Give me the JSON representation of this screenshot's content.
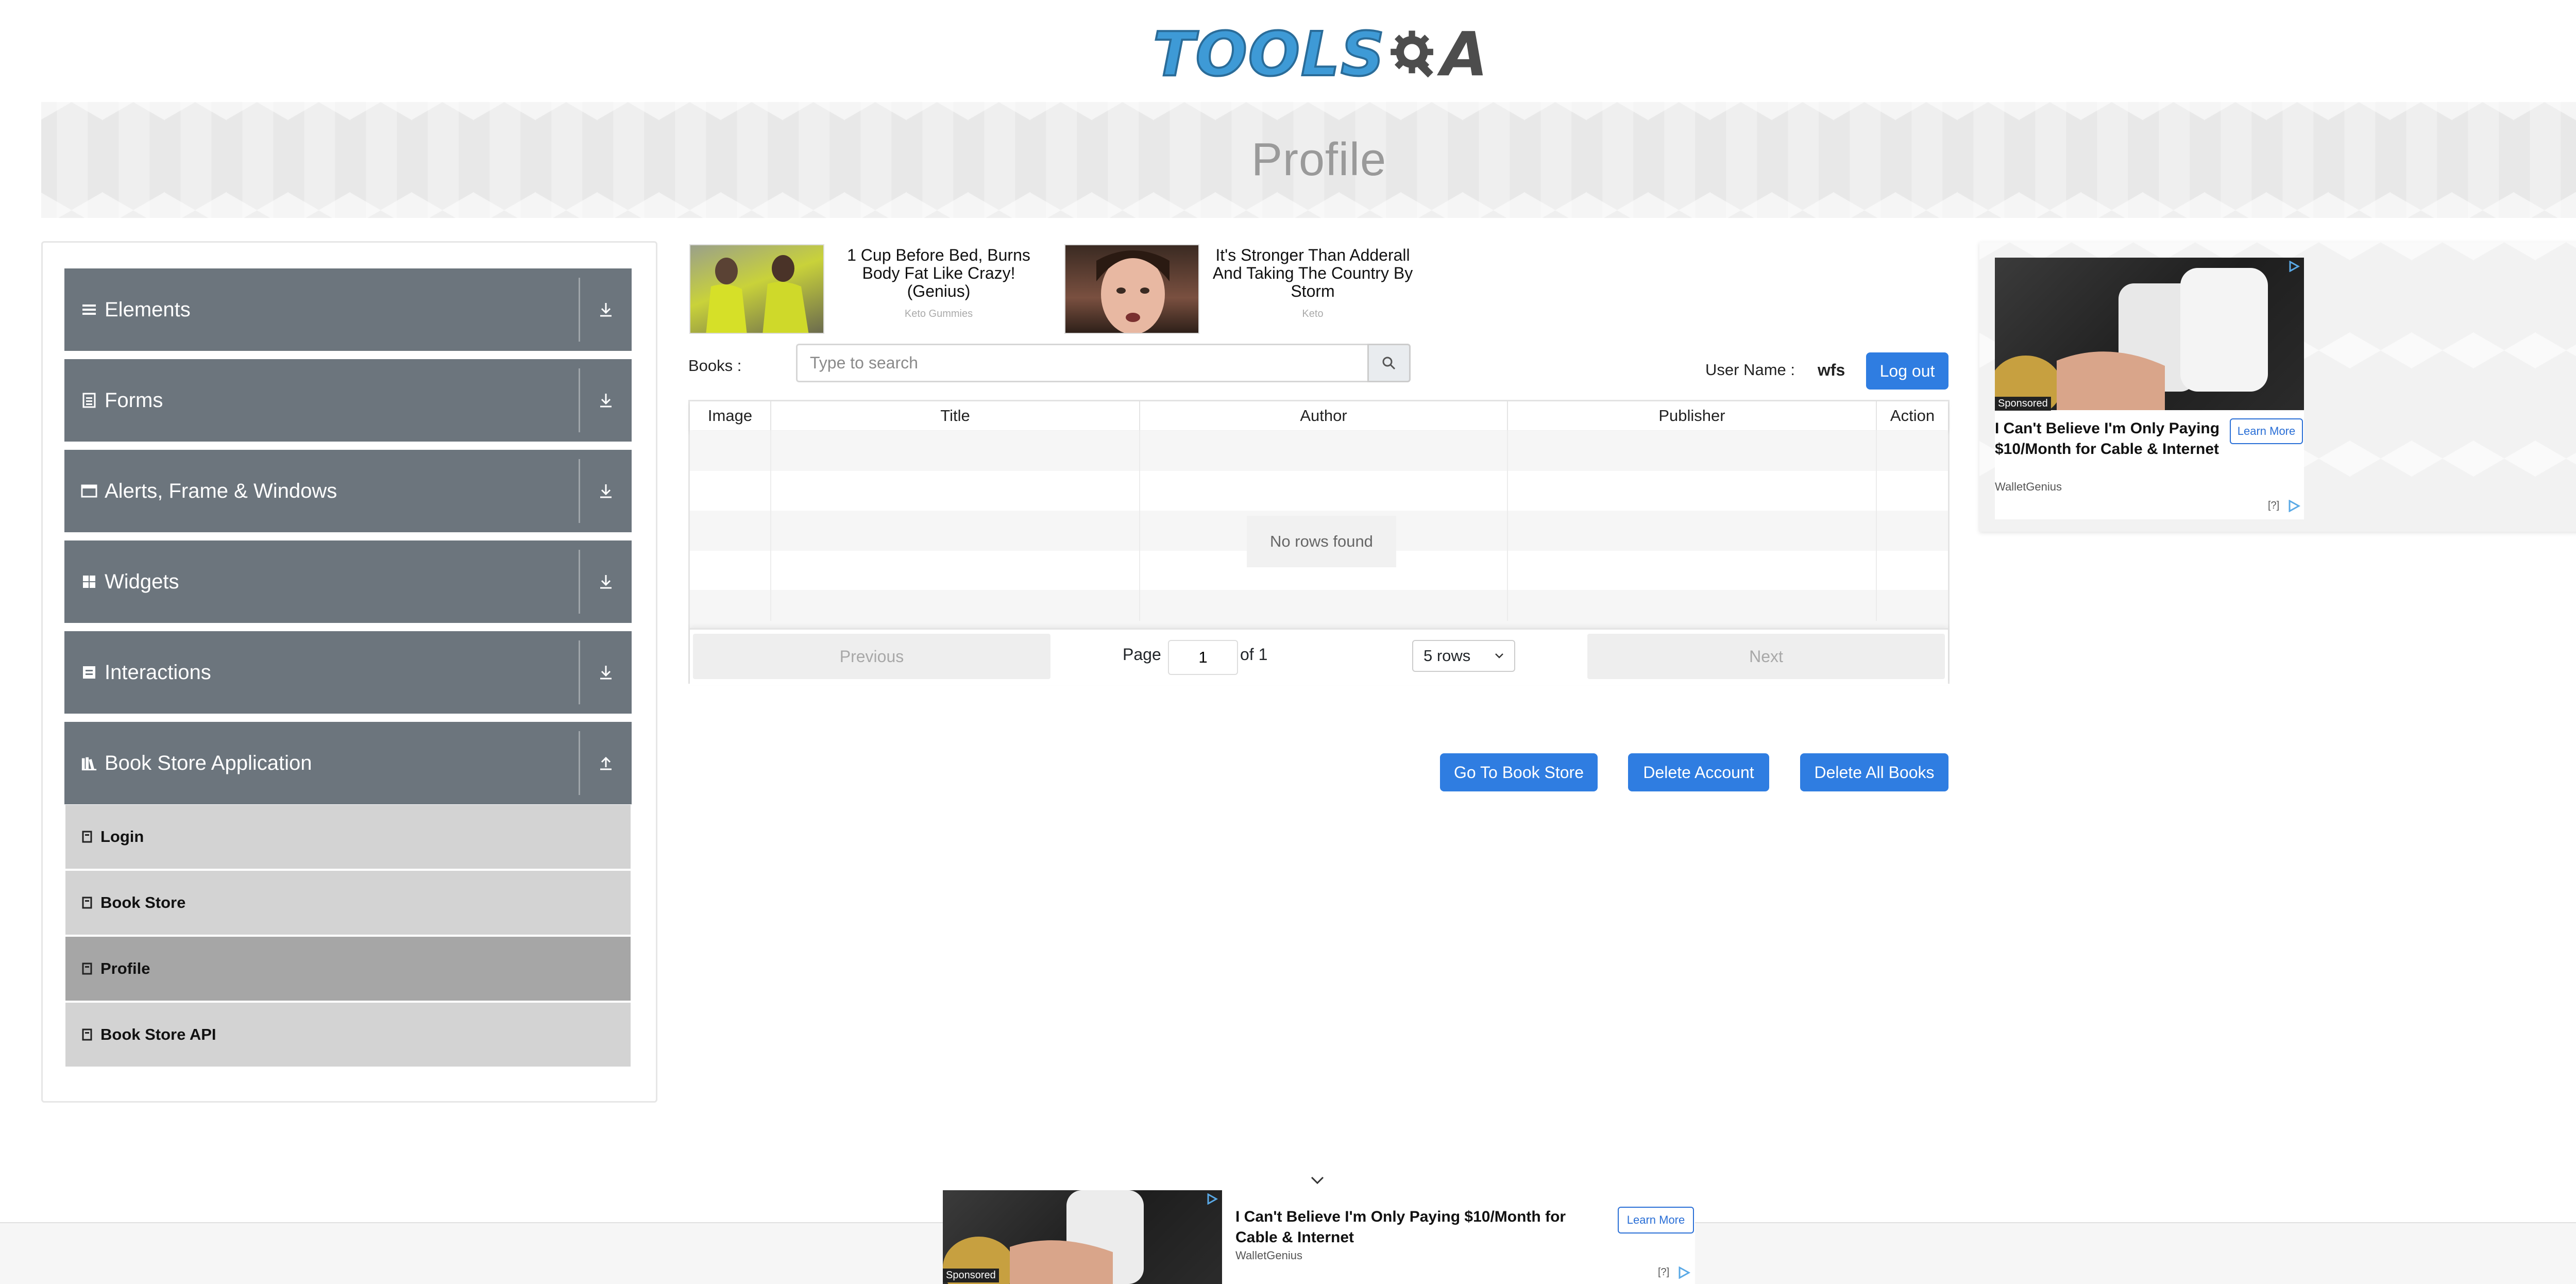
{
  "header": {
    "logo_text_main": "TOOLS",
    "logo_text_end": "A",
    "logo_alt": "TOOLSQA"
  },
  "banner": {
    "title": "Profile"
  },
  "sidebar": {
    "groups": [
      {
        "label": "Elements",
        "icon": "list-icon"
      },
      {
        "label": "Forms",
        "icon": "form-icon"
      },
      {
        "label": "Alerts, Frame & Windows",
        "icon": "window-icon"
      },
      {
        "label": "Widgets",
        "icon": "grid-icon"
      },
      {
        "label": "Interactions",
        "icon": "interaction-icon"
      },
      {
        "label": "Book Store Application",
        "icon": "books-icon",
        "expanded": true
      }
    ],
    "subitems": [
      {
        "label": "Login"
      },
      {
        "label": "Book Store"
      },
      {
        "label": "Profile",
        "active": true
      },
      {
        "label": "Book Store API"
      }
    ]
  },
  "ads_top": [
    {
      "headline": "1 Cup Before Bed, Burns Body Fat Like Crazy! (Genius)",
      "source": "Keto Gummies"
    },
    {
      "headline": "It's Stronger Than Adderall And Taking The Country By Storm",
      "source": "Keto"
    }
  ],
  "books": {
    "label": "Books :",
    "search_placeholder": "Type to search",
    "user_label": "User Name :",
    "user_name": "wfs",
    "logout": "Log out"
  },
  "table": {
    "columns": [
      "Image",
      "Title",
      "Author",
      "Publisher",
      "Action"
    ],
    "empty_text": "No rows found",
    "pagination": {
      "previous": "Previous",
      "page_label": "Page",
      "page_value": "1",
      "of_label": "of 1",
      "rows_select": "5 rows",
      "next": "Next"
    }
  },
  "actions": {
    "go_to_store": "Go To Book Store",
    "delete_account": "Delete Account",
    "delete_all": "Delete All Books"
  },
  "right_ad": {
    "sponsored": "Sponsored",
    "headline": "I Can't Believe I'm Only Paying $10/Month for Cable & Internet",
    "source": "WalletGenius",
    "cta": "Learn More",
    "info": "[?]"
  },
  "bottom_ad": {
    "sponsored": "Sponsored",
    "headline": "I Can't Believe I'm Only Paying $10/Month for Cable & Internet",
    "source": "WalletGenius",
    "cta": "Learn More",
    "info": "[?]"
  },
  "colors": {
    "primary": "#2f7de1",
    "menu_group": "#6c757d",
    "menu_sub": "#d3d3d3",
    "menu_active": "#a6a6a6",
    "banner_text": "#9a9a9a"
  }
}
